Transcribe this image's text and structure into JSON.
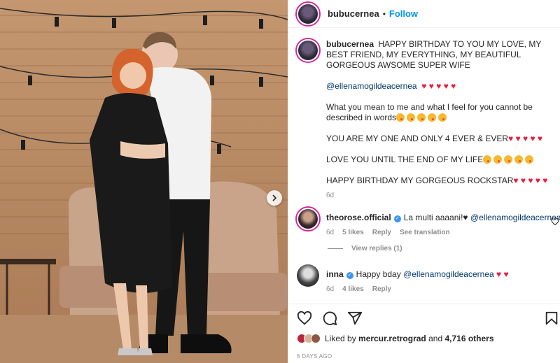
{
  "post": {
    "username": "bubucernea",
    "follow_label": "Follow",
    "dot": "•"
  },
  "caption": {
    "username": "bubucernea",
    "line1": "HAPPY BIRTHDAY TO YOU MY LOVE, MY BEST FRIEND, MY EVERYTHING, MY BEAUTIFUL GORGEOUS AWSOME SUPER WIFE",
    "mention": "@ellenamogildeacernea",
    "line2": "What you mean to me and what I feel for you cannot be described in words",
    "line3": "YOU ARE MY ONE AND ONLY 4 EVER & EVER",
    "line4": "LOVE YOU UNTIL THE END OF MY LIFE",
    "line5": "HAPPY BIRTHDAY MY GORGEOUS ROCKSTAR",
    "time": "6d"
  },
  "comments": [
    {
      "username": "theorose.official",
      "text": "La multi aaaani!♥",
      "mention": "@ellenamogildeacernea",
      "time": "6d",
      "likes": "5 likes",
      "reply": "Reply",
      "translate": "See translation"
    },
    {
      "username": "inna",
      "text": "Happy bday",
      "mention": "@ellenamogildeacernea",
      "time": "6d",
      "likes": "4 likes",
      "reply": "Reply"
    }
  ],
  "view_replies": "View replies (1)",
  "likes": {
    "prefix": "Liked by",
    "user": "mercur.retrograd",
    "and": "and",
    "others": "4,716 others"
  },
  "time_ago": "6 DAYS AGO",
  "colors": {
    "accent": "#0095f6",
    "heart": "#ed1b3c",
    "mention": "#00376b",
    "muted": "#8e8e8e"
  },
  "icons": [
    "heart-icon",
    "comment-icon",
    "share-icon",
    "save-icon",
    "verified-icon",
    "chevron-right-icon"
  ]
}
